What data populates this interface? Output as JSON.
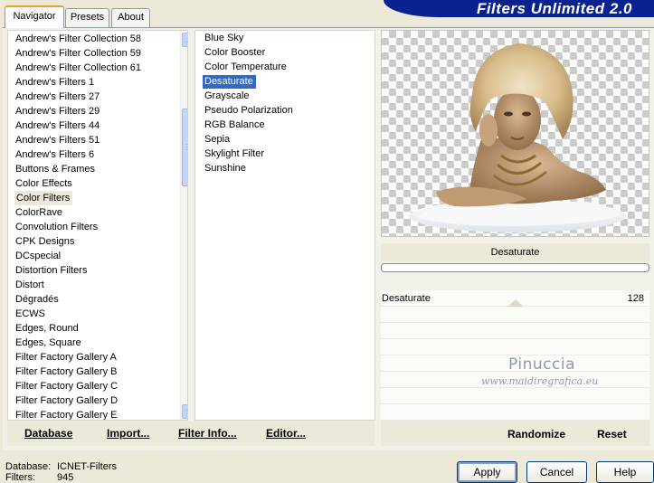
{
  "app": {
    "banner_title": "Filters Unlimited 2.0"
  },
  "tabs": [
    {
      "label": "Navigator",
      "active": true
    },
    {
      "label": "Presets",
      "active": false
    },
    {
      "label": "About",
      "active": false
    }
  ],
  "categories": {
    "items": [
      "Andrew's Filter Collection 58",
      "Andrew's Filter Collection 59",
      "Andrew's Filter Collection 61",
      "Andrew's Filters 1",
      "Andrew's Filters 27",
      "Andrew's Filters 29",
      "Andrew's Filters 44",
      "Andrew's Filters 51",
      "Andrew's Filters 6",
      "Buttons & Frames",
      "Color Effects",
      "Color Filters",
      "ColorRave",
      "Convolution Filters",
      "CPK Designs",
      "DCspecial",
      "Distortion Filters",
      "Distort",
      "Dégradés",
      "ECWS",
      "Edges, Round",
      "Edges, Square",
      "Filter Factory Gallery A",
      "Filter Factory Gallery B",
      "Filter Factory Gallery C",
      "Filter Factory Gallery D",
      "Filter Factory Gallery E"
    ],
    "selected": "Color Filters",
    "scroll_up_glyph": "▲",
    "scroll_down_glyph": "▼"
  },
  "filters": {
    "items": [
      "Blue Sky",
      "Color Booster",
      "Color Temperature",
      "Desaturate",
      "Grayscale",
      "Pseudo Polarization",
      "RGB Balance",
      "Sepia",
      "Skylight Filter",
      "Sunshine"
    ],
    "selected": "Desaturate"
  },
  "toolbar": {
    "database": "Database",
    "import": "Import...",
    "filter_info": "Filter Info...",
    "editor": "Editor..."
  },
  "preview": {
    "filter_name": "Desaturate",
    "parameter_label": "Desaturate",
    "parameter_value": "128",
    "watermark_name": "Pinuccia",
    "watermark_url": "www.maidiregrafica.eu"
  },
  "right_buttons": {
    "randomize": "Randomize",
    "reset": "Reset"
  },
  "status": {
    "database_label": "Database:",
    "database_value": "ICNET-Filters",
    "filters_label": "Filters:",
    "filters_value": "945"
  },
  "dialog_buttons": {
    "apply": "Apply",
    "cancel": "Cancel",
    "help": "Help"
  },
  "colors": {
    "banner": "#0a2290",
    "selection": "#316ac5",
    "face": "#ece9d8"
  }
}
